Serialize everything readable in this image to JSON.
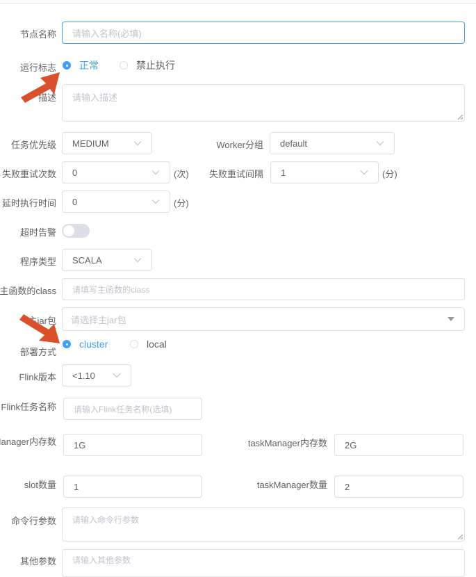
{
  "form": {
    "node_name": {
      "label": "节点名称",
      "placeholder": "请输入名称(必填)"
    },
    "run_flag": {
      "label": "运行标志",
      "options": [
        "正常",
        "禁止执行"
      ],
      "selected": "正常"
    },
    "description": {
      "label": "描述",
      "placeholder": "请输入描述"
    },
    "task_priority": {
      "label": "任务优先级",
      "value": "MEDIUM"
    },
    "worker_group": {
      "label": "Worker分组",
      "value": "default"
    },
    "fail_retry_times": {
      "label": "失败重试次数",
      "value": "0",
      "unit": "(次)"
    },
    "fail_retry_interval": {
      "label": "失败重试间隔",
      "value": "1",
      "unit": "(分)"
    },
    "delay_time": {
      "label": "延时执行时间",
      "value": "0",
      "unit": "(分)"
    },
    "timeout_alarm": {
      "label": "超时告警",
      "enabled": false
    },
    "program_type": {
      "label": "程序类型",
      "value": "SCALA"
    },
    "main_class": {
      "label": "主函数的class",
      "placeholder": "请填写主函数的class"
    },
    "main_jar": {
      "label": "主jar包",
      "placeholder": "请选择主jar包"
    },
    "deploy_mode": {
      "label": "部署方式",
      "options": [
        "cluster",
        "local"
      ],
      "selected": "cluster"
    },
    "flink_version": {
      "label": "Flink版本",
      "value": "<1.10"
    },
    "flink_task_name": {
      "label": "Flink任务名称",
      "placeholder": "请输入Flink任务名称(选填)"
    },
    "job_manager_memory": {
      "label": "jobManager内存数",
      "value": "1G"
    },
    "task_manager_memory": {
      "label": "taskManager内存数",
      "value": "2G"
    },
    "slot_count": {
      "label": "slot数量",
      "value": "1"
    },
    "task_manager_count": {
      "label": "taskManager数量",
      "value": "2"
    },
    "command_args": {
      "label": "命令行参数",
      "placeholder": "请输入命令行参数"
    },
    "other_args": {
      "label": "其他参数",
      "placeholder": "请输入其他参数"
    }
  },
  "colors": {
    "accent": "#409eff",
    "arrow": "#d9512c"
  },
  "annotations": {
    "arrow_icon": "red-arrow-icon"
  }
}
